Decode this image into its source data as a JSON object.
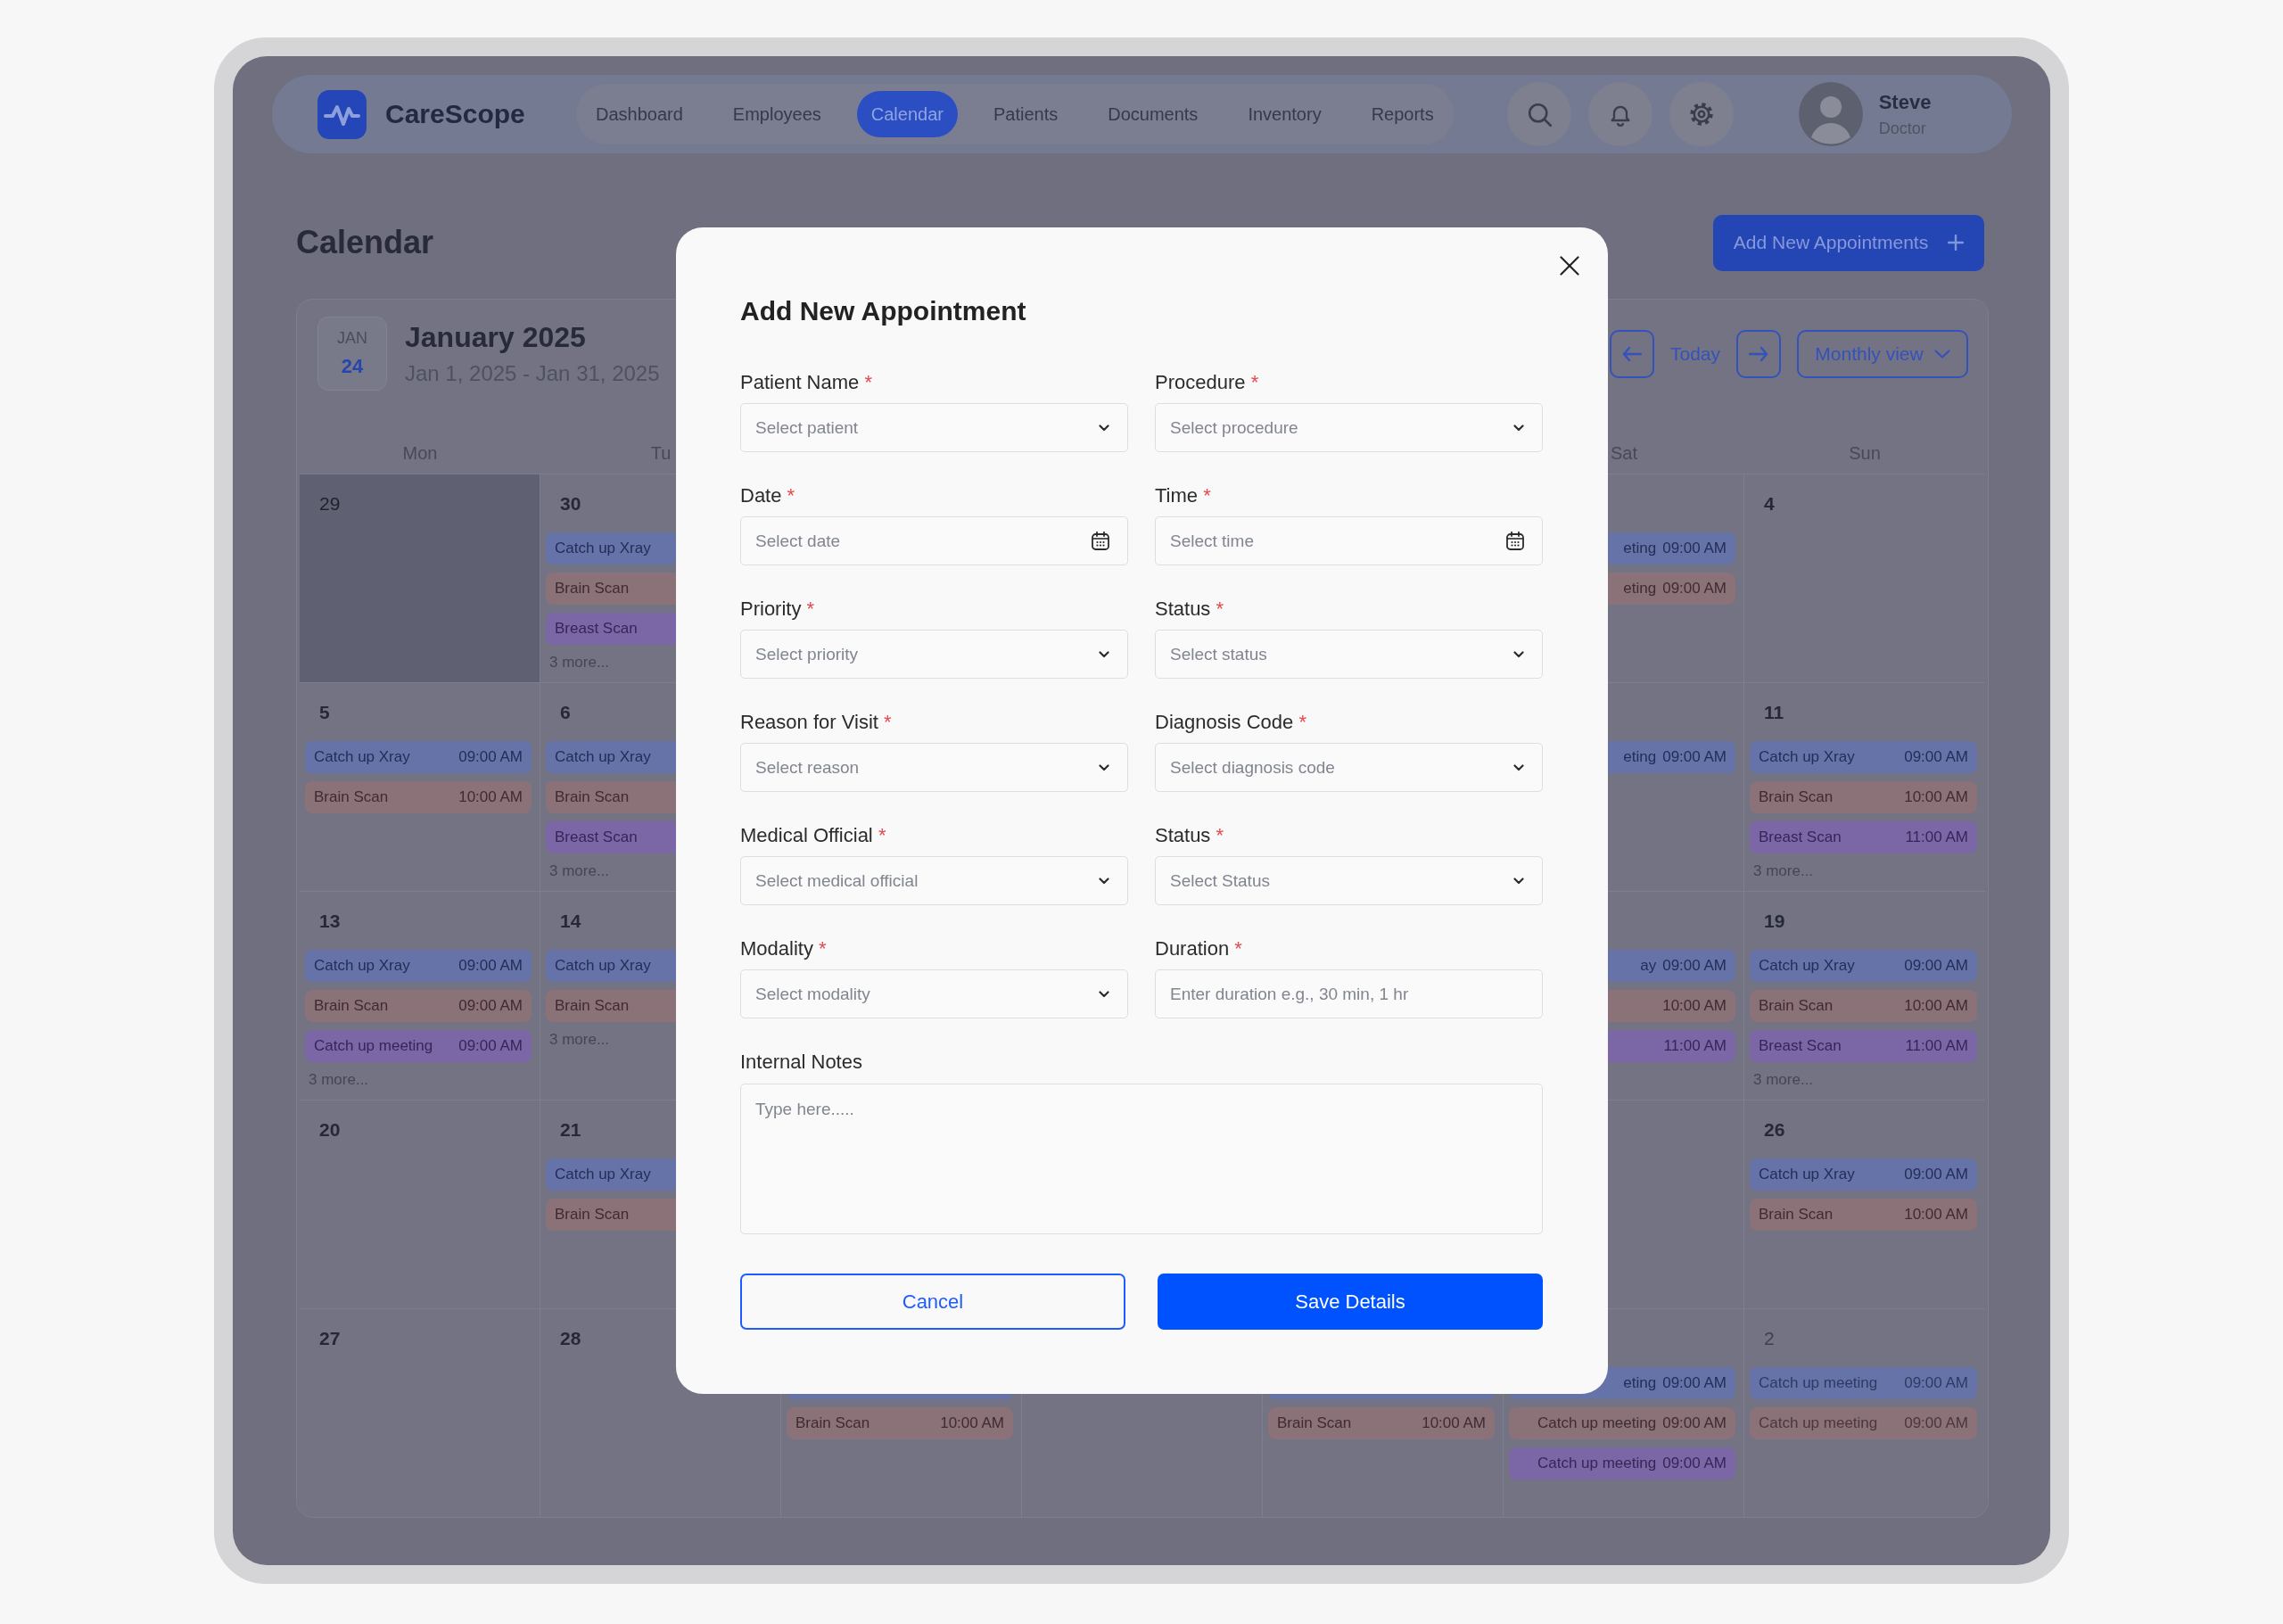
{
  "nav": {
    "brand": "CareScope",
    "tabs": [
      {
        "label": "Dashboard",
        "selected": false
      },
      {
        "label": "Employees",
        "selected": false
      },
      {
        "label": "Calendar",
        "selected": true
      },
      {
        "label": "Patients",
        "selected": false
      },
      {
        "label": "Documents",
        "selected": false
      },
      {
        "label": "Inventory",
        "selected": false
      },
      {
        "label": "Reports",
        "selected": false
      }
    ],
    "user": {
      "name": "Steve",
      "role": "Doctor"
    }
  },
  "page": {
    "title": "Calendar",
    "add_button": "Add New Appointments"
  },
  "calendar": {
    "badge": {
      "month": "JAN",
      "day": "24"
    },
    "title": "January 2025",
    "range": "Jan 1, 2025 - Jan 31, 2025",
    "today": "Today",
    "view": "Monthly view",
    "columns": [
      {
        "weekday": "Mon",
        "clipped": false,
        "days": [
          {
            "date": "29",
            "shaded": true,
            "faded": false
          },
          {
            "date": "5",
            "shaded": false,
            "faded": false,
            "events": [
              {
                "title": "Catch up Xray",
                "time": "09:00 AM",
                "color": "#6673a8"
              },
              {
                "title": "Brain Scan",
                "time": "10:00 AM",
                "color": "#8a7278"
              }
            ]
          },
          {
            "date": "13",
            "shaded": false,
            "faded": false,
            "events": [
              {
                "title": "Catch up Xray",
                "time": "09:00 AM",
                "color": "#6673a8"
              },
              {
                "title": "Brain Scan",
                "time": "09:00 AM",
                "color": "#8a7278"
              },
              {
                "title": "Catch up meeting",
                "time": "09:00 AM",
                "color": "#7c67a6"
              }
            ],
            "more": "3 more..."
          },
          {
            "date": "20",
            "shaded": false,
            "faded": false
          },
          {
            "date": "27",
            "shaded": false,
            "faded": false
          }
        ]
      },
      {
        "weekday": "Tu",
        "clipped": false,
        "days": [
          {
            "date": "30",
            "shaded": false,
            "faded": false,
            "events": [
              {
                "title": "Catch up Xray",
                "color": "#6673a8"
              },
              {
                "title": "Brain Scan",
                "color": "#8a7278"
              },
              {
                "title": "Breast Scan",
                "color": "#7c67a6"
              }
            ],
            "more": "3 more..."
          },
          {
            "date": "6",
            "shaded": false,
            "faded": false,
            "events": [
              {
                "title": "Catch up Xray",
                "color": "#6673a8"
              },
              {
                "title": "Brain Scan",
                "color": "#8a7278"
              },
              {
                "title": "Breast Scan",
                "color": "#7c67a6"
              }
            ],
            "more": "3 more..."
          },
          {
            "date": "14",
            "shaded": false,
            "faded": false,
            "events": [
              {
                "title": "Catch up Xray",
                "color": "#6673a8"
              },
              {
                "title": "Brain Scan",
                "color": "#8a7278"
              }
            ],
            "more": "3 more..."
          },
          {
            "date": "21",
            "shaded": false,
            "faded": false,
            "events": [
              {
                "title": "Catch up Xray",
                "color": "#6673a8"
              },
              {
                "title": "Brain Scan",
                "color": "#8a7278"
              }
            ]
          },
          {
            "date": "28",
            "shaded": false,
            "faded": false
          }
        ]
      },
      {
        "clipped": false,
        "days": [
          {
            "shaded": false,
            "faded": false,
            "events": [
              {
                "color": "#6673a8"
              },
              {
                "title": "Brain Scan",
                "time": "10:00 AM",
                "color": "#8a7278"
              }
            ]
          }
        ]
      },
      {
        "days": [
          {
            "shaded": false
          }
        ]
      },
      {
        "clipped": false,
        "days": [
          {
            "shaded": false,
            "faded": false,
            "events": [
              {
                "color": "#6673a8"
              },
              {
                "title": "Brain Scan",
                "time": "10:00 AM",
                "color": "#8a7278"
              }
            ]
          }
        ]
      },
      {
        "weekday": "Sat",
        "clipped": true,
        "days": [
          {
            "shaded": false,
            "faded": false,
            "events": [
              {
                "title": "eting",
                "time": "09:00 AM",
                "color": "#6673a8"
              },
              {
                "title": "eting",
                "time": "09:00 AM",
                "color": "#8a7278"
              }
            ]
          },
          {
            "shaded": false,
            "faded": false,
            "events": [
              {
                "title": "eting",
                "time": "09:00 AM",
                "color": "#6673a8"
              }
            ]
          },
          {
            "shaded": false,
            "faded": false,
            "events": [
              {
                "title": "ay",
                "time": "09:00 AM",
                "color": "#6673a8"
              },
              {
                "time": "10:00 AM",
                "color": "#8a7278"
              },
              {
                "time": "11:00 AM",
                "color": "#7c67a6"
              }
            ]
          },
          {
            "shaded": false
          },
          {
            "shaded": false,
            "faded": false,
            "events": [
              {
                "title": "eting",
                "time": "09:00 AM",
                "color": "#6673a8"
              },
              {
                "title": "Catch up meeting",
                "time": "09:00 AM",
                "color": "#8a7278"
              },
              {
                "title": "Catch up meeting",
                "time": "09:00 AM",
                "color": "#7c67a6"
              }
            ]
          }
        ]
      },
      {
        "weekday": "Sun",
        "clipped": false,
        "days": [
          {
            "date": "4",
            "shaded": false,
            "faded": false
          },
          {
            "date": "11",
            "shaded": false,
            "faded": false,
            "events": [
              {
                "title": "Catch up Xray",
                "time": "09:00 AM",
                "color": "#6673a8"
              },
              {
                "title": "Brain Scan",
                "time": "10:00 AM",
                "color": "#8a7278"
              },
              {
                "title": "Breast Scan",
                "time": "11:00 AM",
                "color": "#7c67a6"
              }
            ],
            "more": "3 more..."
          },
          {
            "date": "19",
            "shaded": false,
            "faded": false,
            "events": [
              {
                "title": "Catch up Xray",
                "time": "09:00 AM",
                "color": "#6673a8"
              },
              {
                "title": "Brain Scan",
                "time": "10:00 AM",
                "color": "#8a7278"
              },
              {
                "title": "Breast Scan",
                "time": "11:00 AM",
                "color": "#7c67a6"
              }
            ],
            "more": "3 more..."
          },
          {
            "date": "26",
            "shaded": false,
            "faded": false,
            "events": [
              {
                "title": "Catch up Xray",
                "time": "09:00 AM",
                "color": "#6673a8"
              },
              {
                "title": "Brain Scan",
                "time": "10:00 AM",
                "color": "#8a7278"
              }
            ]
          },
          {
            "date": "2",
            "shaded": false,
            "faded": true,
            "events": [
              {
                "title": "Catch up meeting",
                "time": "09:00 AM",
                "color": "#6673a8"
              },
              {
                "title": "Catch up meeting",
                "time": "09:00 AM",
                "color": "#8a7278"
              }
            ]
          }
        ]
      }
    ]
  },
  "dialog": {
    "title": "Add New Appointment",
    "fields": [
      {
        "label": "Patient Name",
        "required_mark": "*",
        "kind": "select",
        "placeholder": "Select patient"
      },
      {
        "label": "Procedure",
        "required_mark": "*",
        "kind": "select",
        "placeholder": "Select procedure"
      },
      {
        "label": "Date",
        "required_mark": "*",
        "kind": "picker",
        "placeholder": "Select date"
      },
      {
        "label": "Time",
        "required_mark": "*",
        "kind": "picker",
        "placeholder": "Select time"
      },
      {
        "label": "Priority",
        "required_mark": "*",
        "kind": "select",
        "placeholder": "Select priority"
      },
      {
        "label": "Status",
        "required_mark": "*",
        "kind": "select",
        "placeholder": "Select status"
      },
      {
        "label": "Reason for Visit",
        "required_mark": "*",
        "kind": "select",
        "placeholder": "Select reason"
      },
      {
        "label": "Diagnosis Code",
        "required_mark": "*",
        "kind": "select",
        "placeholder": "Select diagnosis code"
      },
      {
        "label": "Medical Official",
        "required_mark": "*",
        "kind": "select",
        "placeholder": "Select medical official"
      },
      {
        "label": "Status",
        "required_mark": "*",
        "kind": "select",
        "placeholder": "Select Status"
      },
      {
        "label": "Modality",
        "required_mark": "*",
        "kind": "select",
        "placeholder": "Select modality"
      },
      {
        "label": "Duration",
        "required_mark": "*",
        "kind": "text",
        "placeholder": "Enter duration e.g., 30 min, 1 hr"
      },
      {
        "label": "Internal Notes",
        "kind": "textarea",
        "placeholder": "Type here....."
      }
    ],
    "buttons": [
      {
        "label": "Cancel",
        "kind": "secondary"
      },
      {
        "label": "Save Details",
        "kind": "primary"
      }
    ]
  }
}
